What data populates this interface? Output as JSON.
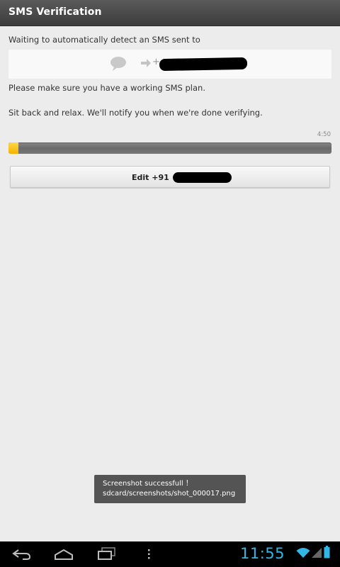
{
  "title_bar": {
    "title": "SMS Verification"
  },
  "main": {
    "waiting_text": "Waiting to automatically detect an SMS sent to",
    "number_box": {
      "plus": "+",
      "number_redacted": true
    },
    "plan_text": "Please make sure you have a working SMS plan.",
    "relax_text": "Sit back and relax. We'll notify you when we're done verifying.",
    "timer": "4:50",
    "progress_fraction": 0.03,
    "edit_button_label": "Edit +91 "
  },
  "toast": {
    "line1": "Screenshot successfull ！",
    "line2": "sdcard/screenshots/shot_000017.png"
  },
  "nav_bar": {
    "icons": [
      "back-icon",
      "home-icon",
      "recent-apps-icon",
      "menu-icon"
    ],
    "clock": "11:55",
    "status_icons": [
      "wifi-icon",
      "signal-icon",
      "battery-icon"
    ]
  },
  "colors": {
    "accent_blue": "#33b5e5",
    "progress_yellow": "#f4b400",
    "title_bar": "#4a4a4a",
    "background": "#ececec"
  }
}
